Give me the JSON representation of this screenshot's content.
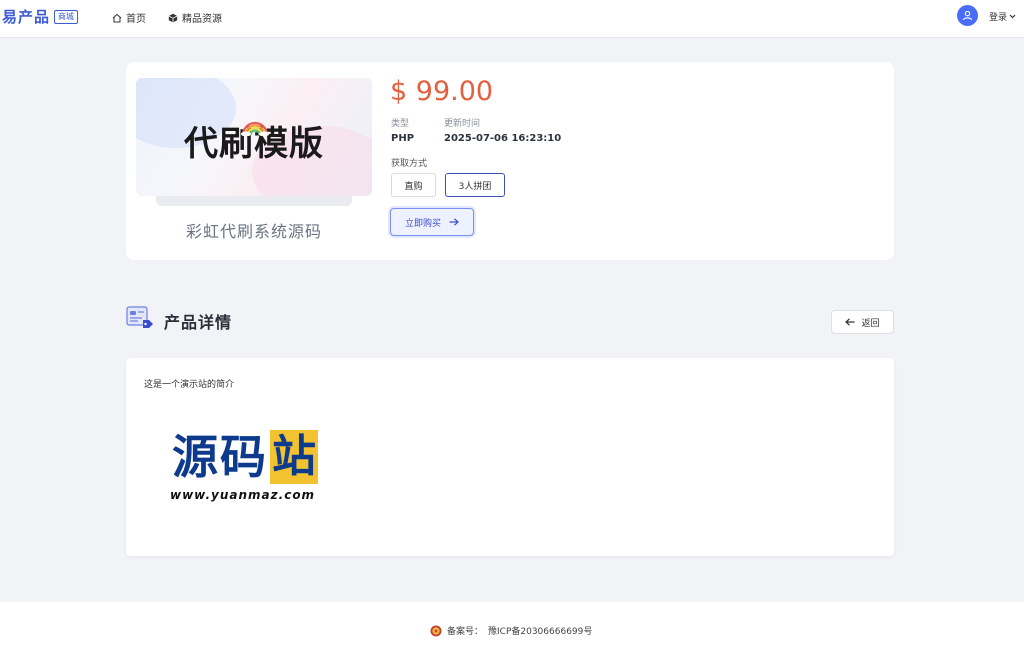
{
  "header": {
    "brand_name": "易产品",
    "brand_tag": "商城",
    "nav": [
      {
        "label": "首页",
        "icon": "home-icon"
      },
      {
        "label": "精品资源",
        "icon": "cube-icon"
      }
    ],
    "login_label": "登录"
  },
  "product": {
    "cover_title": "代刷模版",
    "name": "彩虹代刷系统源码",
    "price": "$ 99.00",
    "type_label": "类型",
    "type_value": "PHP",
    "updated_label": "更新时间",
    "updated_value": "2025-07-06 16:23:10",
    "acquire_label": "获取方式",
    "options": [
      "直购",
      "3人拼团"
    ],
    "selected_option": "3人拼团",
    "buy_label": "立即购买"
  },
  "details": {
    "title": "产品详情",
    "back_label": "返回",
    "intro": "这是一个演示站的简介",
    "logo_text": "源码站",
    "logo_url": "www.yuanmaz.com"
  },
  "footer": {
    "icp_label": "备案号：",
    "icp_value": "豫ICP备20306666699号"
  },
  "colors": {
    "accent": "#3b5bd9",
    "price": "#e3603e",
    "page_bg": "#f2f3f7"
  }
}
